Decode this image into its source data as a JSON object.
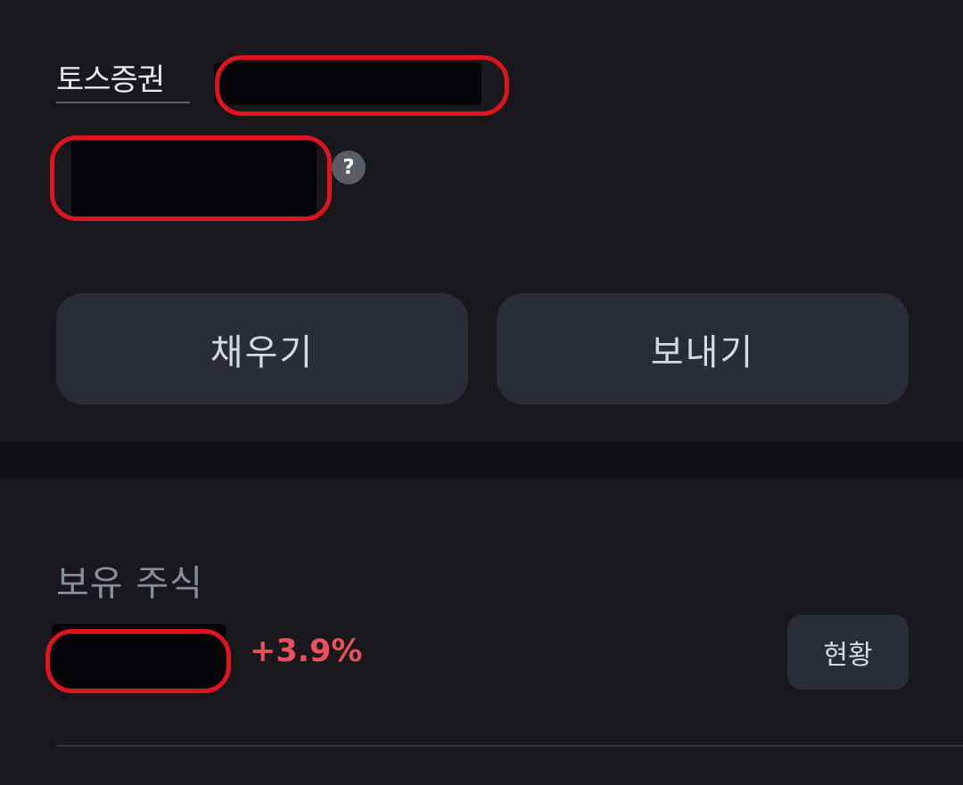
{
  "account": {
    "brand": "토스증권",
    "help_icon": "?"
  },
  "actions": {
    "fill_label": "채우기",
    "send_label": "보내기"
  },
  "holdings": {
    "title": "보유 주식",
    "change": "+3.9%",
    "status_label": "현황"
  },
  "colors": {
    "background": "#18181d",
    "button": "#2b2c35",
    "positive": "#e8505e",
    "annotation": "#e0141e"
  }
}
